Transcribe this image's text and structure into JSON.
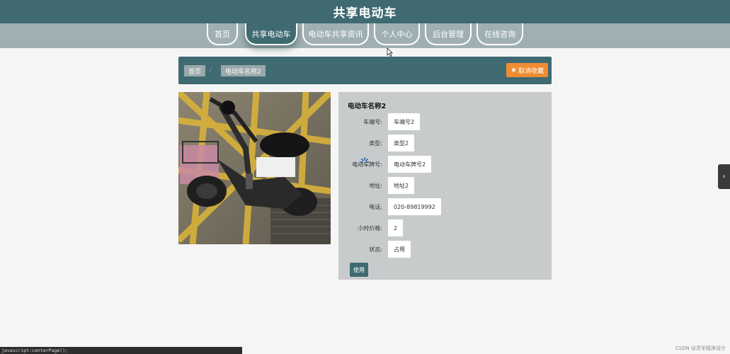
{
  "header": {
    "title": "共享电动车"
  },
  "nav": {
    "items": [
      {
        "label": "首页"
      },
      {
        "label": "共享电动车"
      },
      {
        "label": "电动车共享资讯"
      },
      {
        "label": "个人中心"
      },
      {
        "label": "后台管理"
      },
      {
        "label": "在线咨询"
      }
    ],
    "active_index": 1
  },
  "breadcrumb": {
    "home": "首页",
    "separator": "/",
    "current": "电动车名称2"
  },
  "actions": {
    "favorite_label": "取消收藏",
    "use_label": "使用"
  },
  "detail": {
    "title": "电动车名称2",
    "fields": [
      {
        "label": "车编号:",
        "value": "车编号2"
      },
      {
        "label": "类型:",
        "value": "类型2"
      },
      {
        "label": "电动车牌号:",
        "value": "电动车牌号2"
      },
      {
        "label": "地址:",
        "value": "地址2"
      },
      {
        "label": "电话:",
        "value": "020-89819992"
      },
      {
        "label": "小时价格:",
        "value": "2"
      },
      {
        "label": "状态:",
        "value": "占用"
      }
    ]
  },
  "status_bar": "javascript:centerPage();",
  "watermark": "CSDN @灵军程序设计",
  "colors": {
    "primary": "#3f6a71",
    "nav_bg": "#9fb0b4",
    "accent": "#f08c32",
    "panel": "#c7cbcb"
  }
}
